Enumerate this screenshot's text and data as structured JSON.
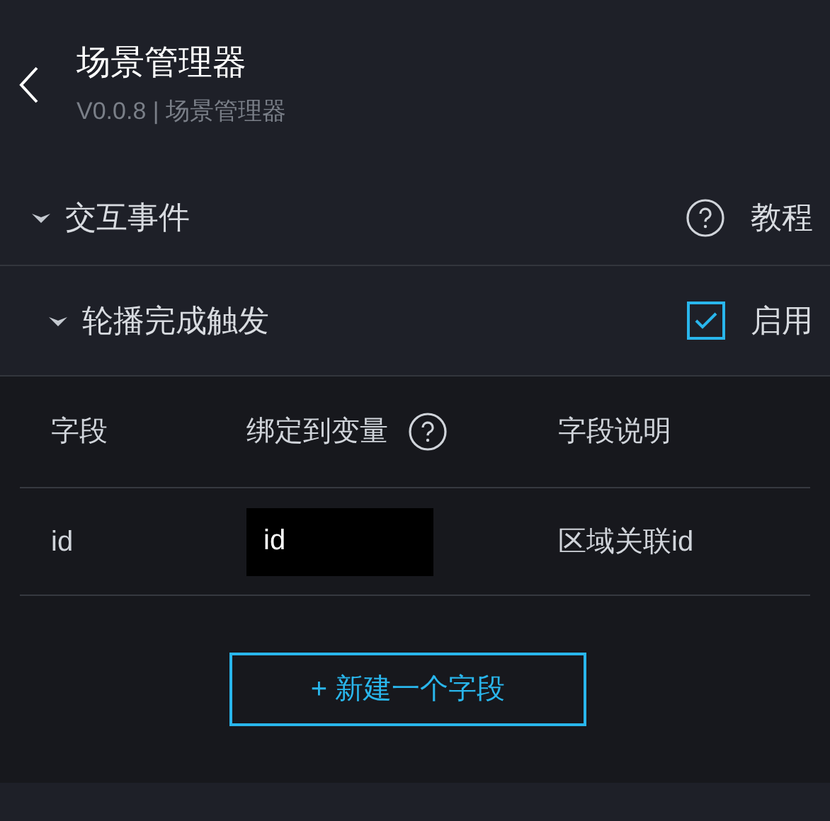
{
  "header": {
    "title": "场景管理器",
    "subtitle": "V0.0.8 | 场景管理器"
  },
  "section": {
    "title": "交互事件",
    "expanded": true,
    "help_label": "教程"
  },
  "event": {
    "title": "轮播完成触发",
    "expanded": true,
    "enabled": true,
    "enabled_label": "启用"
  },
  "table": {
    "columns": [
      {
        "label": "字段",
        "help": false
      },
      {
        "label": "绑定到变量",
        "help": true
      },
      {
        "label": "字段说明",
        "help": false
      }
    ],
    "rows": [
      {
        "field": "id",
        "variable": "id",
        "description": "区域关联id"
      }
    ]
  },
  "add_button": "+ 新建一个字段"
}
